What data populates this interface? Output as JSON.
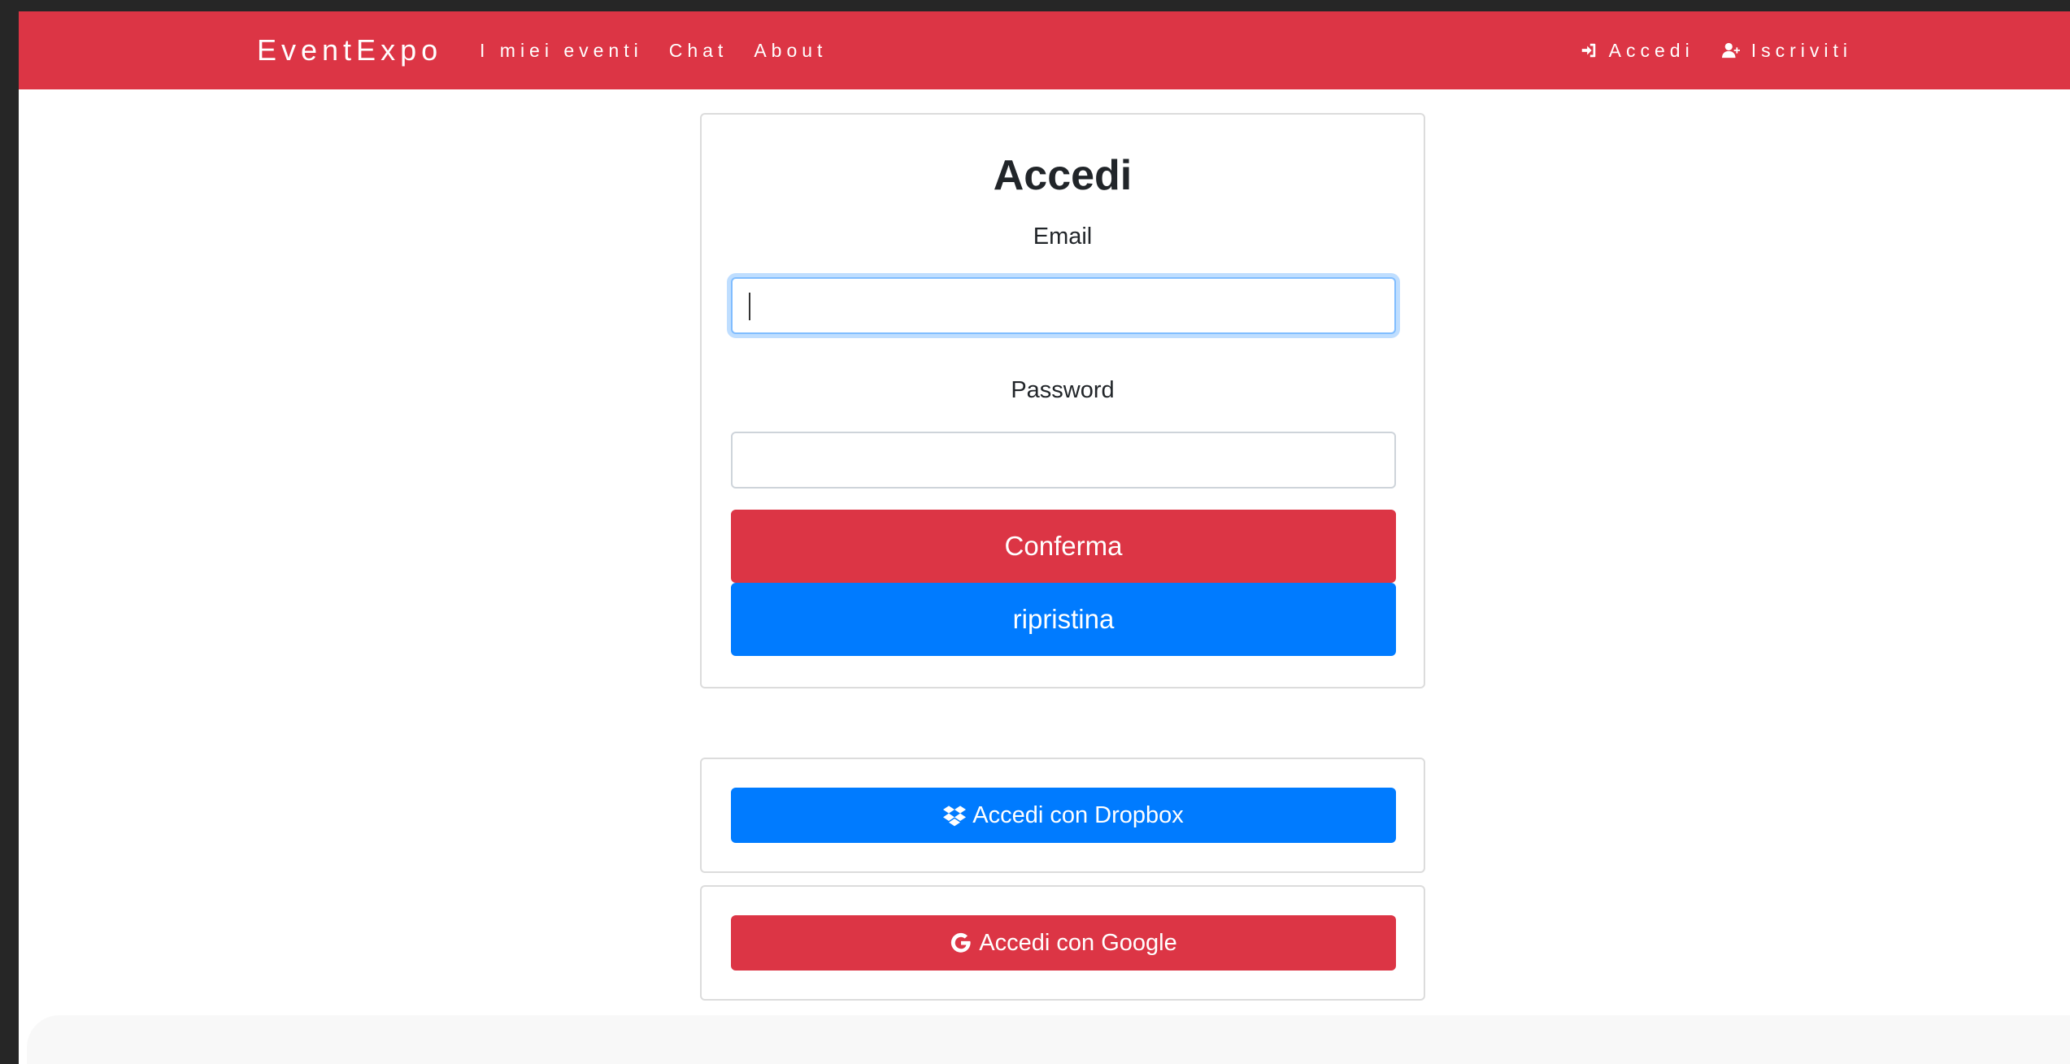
{
  "navbar": {
    "brand": "EventExpo",
    "links": [
      "I miei eventi",
      "Chat",
      "About"
    ],
    "login_label": "Accedi",
    "signup_label": "Iscriviti",
    "login_icon": "sign-in-icon",
    "signup_icon": "user-plus-icon"
  },
  "login_form": {
    "title": "Accedi",
    "email_label": "Email",
    "email_value": "",
    "password_label": "Password",
    "password_value": "",
    "confirm_label": "Conferma",
    "reset_label": "ripristina"
  },
  "oauth": {
    "dropbox_label": "Accedi con Dropbox",
    "dropbox_icon": "dropbox-icon",
    "google_label": "Accedi con Google",
    "google_icon": "google-icon"
  },
  "colors": {
    "primary_red": "#dc3545",
    "primary_blue": "#007bff"
  }
}
